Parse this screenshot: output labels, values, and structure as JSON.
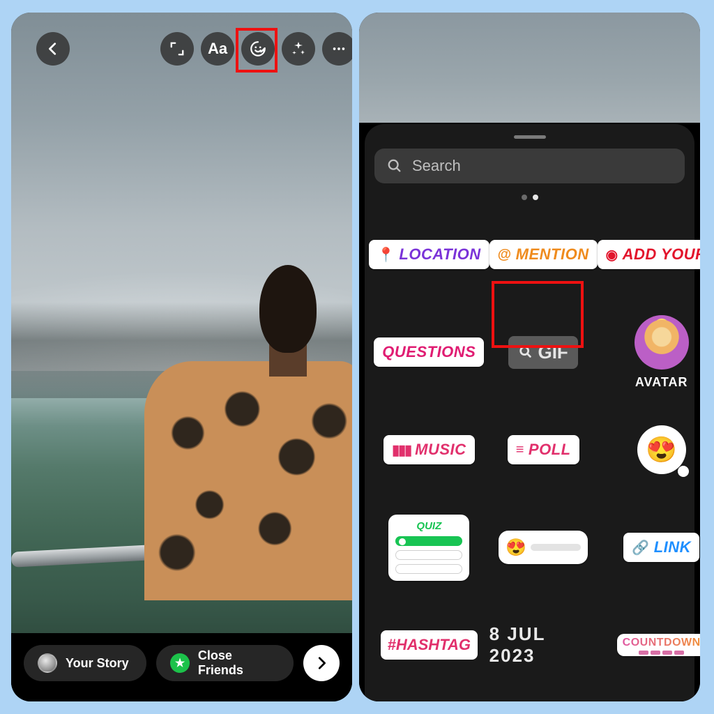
{
  "left": {
    "toolbar": {
      "text_label": "Aa"
    },
    "bottom": {
      "your_story": "Your Story",
      "close_friends": "Close Friends"
    }
  },
  "right": {
    "search_placeholder": "Search",
    "stickers": {
      "location": "LOCATION",
      "mention": "MENTION",
      "add_yours": "ADD YOURS",
      "questions": "QUESTIONS",
      "gif": "GIF",
      "avatar": "AVATAR",
      "music": "MUSIC",
      "poll": "POLL",
      "quiz": "QUIZ",
      "link": "LINK",
      "hashtag": "#HASHTAG",
      "date": "8 JUL 2023",
      "countdown": "COUNTDOWN"
    }
  }
}
